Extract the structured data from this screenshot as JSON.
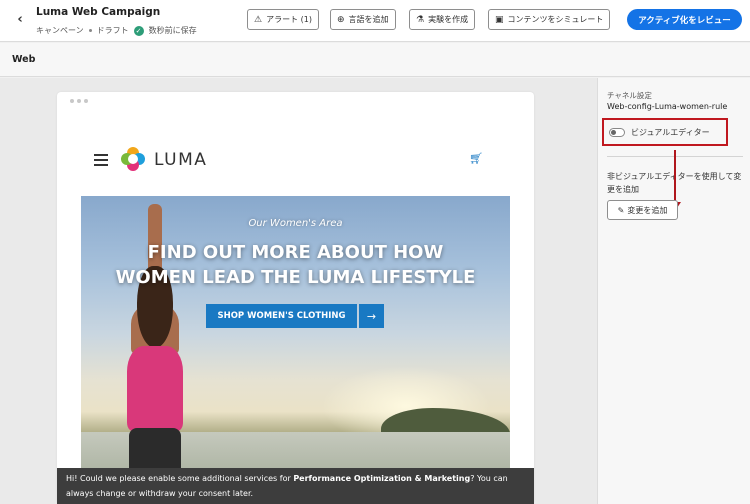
{
  "header": {
    "back_icon": "chevron-left-icon",
    "title": "Luma Web Campaign",
    "meta_type": "キャンペーン",
    "meta_status": "ドラフト",
    "meta_saved": "数秒前に保存",
    "alerts_label": "アラート (1)",
    "add_language_label": "言語を追加",
    "create_experiment_label": "実験を作成",
    "simulate_content_label": "コンテンツをシミュレート",
    "review_activate_label": "アクティブ化をレビュー"
  },
  "subheader": {
    "channel_label": "Web"
  },
  "preview": {
    "logo_text": "LUMA",
    "hero_subtitle": "Our Women's Area",
    "hero_title_line1": "FIND OUT MORE ABOUT HOW",
    "hero_title_line2": "WOMEN LEAD THE LUMA LIFESTYLE",
    "shop_button_label": "SHOP WOMEN'S CLOTHING",
    "shop_arrow": "→"
  },
  "cookie_banner": {
    "text_before": "Hi! Could we please enable some additional services for ",
    "text_bold": "Performance Optimization & Marketing",
    "text_after": "? You can always change or withdraw your consent later."
  },
  "panel": {
    "channel_settings_label": "チャネル設定",
    "channel_settings_value": "Web-config-Luma-women-rule",
    "visual_editor_label": "ビジュアルエディター",
    "visual_editor_enabled": false,
    "help_text": "非ビジュアルエディターを使用して変更を追加",
    "add_change_label": "変更を追加"
  },
  "colors": {
    "primary": "#1473e6",
    "highlight": "#c0181f",
    "luma_blue": "#1979c3",
    "saved_check": "#2d9d78"
  }
}
